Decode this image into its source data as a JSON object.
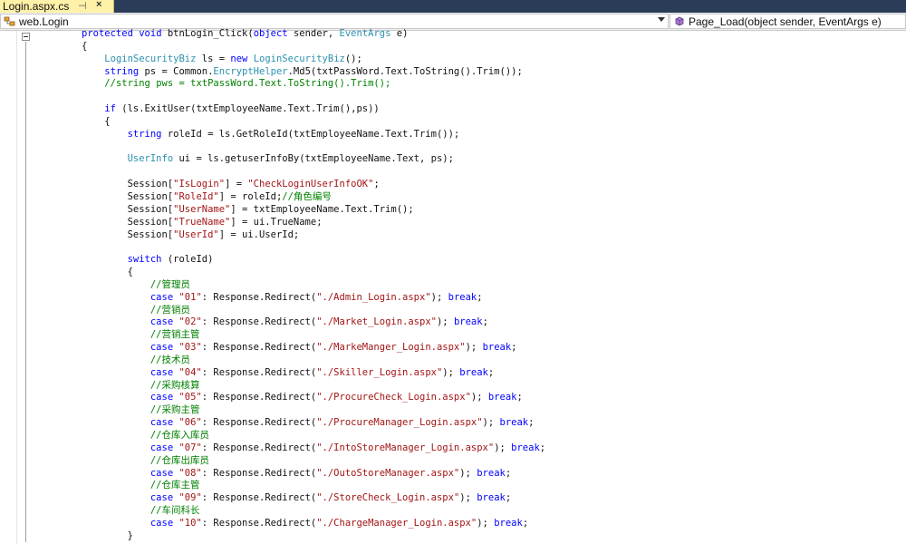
{
  "tab": {
    "title": "Login.aspx.cs",
    "pin": "⊣",
    "close": "×"
  },
  "navbar": {
    "class_combo": "web.Login",
    "member_combo": "Page_Load(object sender, EventArgs e)"
  },
  "code_lines": [
    [
      [
        "kw",
        "protected"
      ],
      [
        "p",
        " "
      ],
      [
        "kw",
        "void"
      ],
      [
        "p",
        " btnLogin_Click("
      ],
      [
        "kw",
        "object"
      ],
      [
        "p",
        " sender, "
      ],
      [
        "ty",
        "EventArgs"
      ],
      [
        "p",
        " e)"
      ]
    ],
    [
      [
        "p",
        "{"
      ]
    ],
    [
      [
        "p",
        "    "
      ],
      [
        "ty",
        "LoginSecurityBiz"
      ],
      [
        "p",
        " ls = "
      ],
      [
        "kw",
        "new"
      ],
      [
        "p",
        " "
      ],
      [
        "ty",
        "LoginSecurityBiz"
      ],
      [
        "p",
        "();"
      ]
    ],
    [
      [
        "p",
        "    "
      ],
      [
        "kw",
        "string"
      ],
      [
        "p",
        " ps = Common."
      ],
      [
        "ty",
        "EncryptHelper"
      ],
      [
        "p",
        ".Md5(txtPassWord.Text.ToString().Trim());"
      ]
    ],
    [
      [
        "p",
        "    "
      ],
      [
        "cm",
        "//string pws = txtPassWord.Text.ToString().Trim();"
      ]
    ],
    [
      [
        "p",
        ""
      ]
    ],
    [
      [
        "p",
        "    "
      ],
      [
        "kw",
        "if"
      ],
      [
        "p",
        " (ls.ExitUser(txtEmployeeName.Text.Trim(),ps))"
      ]
    ],
    [
      [
        "p",
        "    {"
      ]
    ],
    [
      [
        "p",
        "        "
      ],
      [
        "kw",
        "string"
      ],
      [
        "p",
        " roleId = ls.GetRoleId(txtEmployeeName.Text.Trim());"
      ]
    ],
    [
      [
        "p",
        ""
      ]
    ],
    [
      [
        "p",
        "        "
      ],
      [
        "ty",
        "UserInfo"
      ],
      [
        "p",
        " ui = ls.getuserInfoBy(txtEmployeeName.Text, ps);"
      ]
    ],
    [
      [
        "p",
        ""
      ]
    ],
    [
      [
        "p",
        "        Session["
      ],
      [
        "st",
        "\"IsLogin\""
      ],
      [
        "p",
        "] = "
      ],
      [
        "st",
        "\"CheckLoginUserInfoOK\""
      ],
      [
        "p",
        ";"
      ]
    ],
    [
      [
        "p",
        "        Session["
      ],
      [
        "st",
        "\"RoleId\""
      ],
      [
        "p",
        "] = roleId;"
      ],
      [
        "cm",
        "//角色编号"
      ]
    ],
    [
      [
        "p",
        "        Session["
      ],
      [
        "st",
        "\"UserName\""
      ],
      [
        "p",
        "] = txtEmployeeName.Text.Trim();"
      ]
    ],
    [
      [
        "p",
        "        Session["
      ],
      [
        "st",
        "\"TrueName\""
      ],
      [
        "p",
        "] = ui.TrueName;"
      ]
    ],
    [
      [
        "p",
        "        Session["
      ],
      [
        "st",
        "\"UserId\""
      ],
      [
        "p",
        "] = ui.UserId;"
      ]
    ],
    [
      [
        "p",
        ""
      ]
    ],
    [
      [
        "p",
        "        "
      ],
      [
        "kw",
        "switch"
      ],
      [
        "p",
        " (roleId)"
      ]
    ],
    [
      [
        "p",
        "        {"
      ]
    ],
    [
      [
        "p",
        "            "
      ],
      [
        "cm",
        "//管理员"
      ]
    ],
    [
      [
        "p",
        "            "
      ],
      [
        "kw",
        "case"
      ],
      [
        "p",
        " "
      ],
      [
        "st",
        "\"01\""
      ],
      [
        "p",
        ": Response.Redirect("
      ],
      [
        "st",
        "\"./Admin_Login.aspx\""
      ],
      [
        "p",
        "); "
      ],
      [
        "kw",
        "break"
      ],
      [
        "p",
        ";"
      ]
    ],
    [
      [
        "p",
        "            "
      ],
      [
        "cm",
        "//营销员"
      ]
    ],
    [
      [
        "p",
        "            "
      ],
      [
        "kw",
        "case"
      ],
      [
        "p",
        " "
      ],
      [
        "st",
        "\"02\""
      ],
      [
        "p",
        ": Response.Redirect("
      ],
      [
        "st",
        "\"./Market_Login.aspx\""
      ],
      [
        "p",
        "); "
      ],
      [
        "kw",
        "break"
      ],
      [
        "p",
        ";"
      ]
    ],
    [
      [
        "p",
        "            "
      ],
      [
        "cm",
        "//营销主管"
      ]
    ],
    [
      [
        "p",
        "            "
      ],
      [
        "kw",
        "case"
      ],
      [
        "p",
        " "
      ],
      [
        "st",
        "\"03\""
      ],
      [
        "p",
        ": Response.Redirect("
      ],
      [
        "st",
        "\"./MarkeManger_Login.aspx\""
      ],
      [
        "p",
        "); "
      ],
      [
        "kw",
        "break"
      ],
      [
        "p",
        ";"
      ]
    ],
    [
      [
        "p",
        "            "
      ],
      [
        "cm",
        "//技术员"
      ]
    ],
    [
      [
        "p",
        "            "
      ],
      [
        "kw",
        "case"
      ],
      [
        "p",
        " "
      ],
      [
        "st",
        "\"04\""
      ],
      [
        "p",
        ": Response.Redirect("
      ],
      [
        "st",
        "\"./Skiller_Login.aspx\""
      ],
      [
        "p",
        "); "
      ],
      [
        "kw",
        "break"
      ],
      [
        "p",
        ";"
      ]
    ],
    [
      [
        "p",
        "            "
      ],
      [
        "cm",
        "//采购核算"
      ]
    ],
    [
      [
        "p",
        "            "
      ],
      [
        "kw",
        "case"
      ],
      [
        "p",
        " "
      ],
      [
        "st",
        "\"05\""
      ],
      [
        "p",
        ": Response.Redirect("
      ],
      [
        "st",
        "\"./ProcureCheck_Login.aspx\""
      ],
      [
        "p",
        "); "
      ],
      [
        "kw",
        "break"
      ],
      [
        "p",
        ";"
      ]
    ],
    [
      [
        "p",
        "            "
      ],
      [
        "cm",
        "//采购主管"
      ]
    ],
    [
      [
        "p",
        "            "
      ],
      [
        "kw",
        "case"
      ],
      [
        "p",
        " "
      ],
      [
        "st",
        "\"06\""
      ],
      [
        "p",
        ": Response.Redirect("
      ],
      [
        "st",
        "\"./ProcureManager_Login.aspx\""
      ],
      [
        "p",
        "); "
      ],
      [
        "kw",
        "break"
      ],
      [
        "p",
        ";"
      ]
    ],
    [
      [
        "p",
        "            "
      ],
      [
        "cm",
        "//仓库入库员"
      ]
    ],
    [
      [
        "p",
        "            "
      ],
      [
        "kw",
        "case"
      ],
      [
        "p",
        " "
      ],
      [
        "st",
        "\"07\""
      ],
      [
        "p",
        ": Response.Redirect("
      ],
      [
        "st",
        "\"./IntoStoreManager_Login.aspx\""
      ],
      [
        "p",
        "); "
      ],
      [
        "kw",
        "break"
      ],
      [
        "p",
        ";"
      ]
    ],
    [
      [
        "p",
        "            "
      ],
      [
        "cm",
        "//仓库出库员"
      ]
    ],
    [
      [
        "p",
        "            "
      ],
      [
        "kw",
        "case"
      ],
      [
        "p",
        " "
      ],
      [
        "st",
        "\"08\""
      ],
      [
        "p",
        ": Response.Redirect("
      ],
      [
        "st",
        "\"./OutoStoreManager.aspx\""
      ],
      [
        "p",
        "); "
      ],
      [
        "kw",
        "break"
      ],
      [
        "p",
        ";"
      ]
    ],
    [
      [
        "p",
        "            "
      ],
      [
        "cm",
        "//仓库主管"
      ]
    ],
    [
      [
        "p",
        "            "
      ],
      [
        "kw",
        "case"
      ],
      [
        "p",
        " "
      ],
      [
        "st",
        "\"09\""
      ],
      [
        "p",
        ": Response.Redirect("
      ],
      [
        "st",
        "\"./StoreCheck_Login.aspx\""
      ],
      [
        "p",
        "); "
      ],
      [
        "kw",
        "break"
      ],
      [
        "p",
        ";"
      ]
    ],
    [
      [
        "p",
        "            "
      ],
      [
        "cm",
        "//车间科长"
      ]
    ],
    [
      [
        "p",
        "            "
      ],
      [
        "kw",
        "case"
      ],
      [
        "p",
        " "
      ],
      [
        "st",
        "\"10\""
      ],
      [
        "p",
        ": Response.Redirect("
      ],
      [
        "st",
        "\"./ChargeManager_Login.aspx\""
      ],
      [
        "p",
        "); "
      ],
      [
        "kw",
        "break"
      ],
      [
        "p",
        ";"
      ]
    ],
    [
      [
        "p",
        "        }"
      ]
    ]
  ]
}
